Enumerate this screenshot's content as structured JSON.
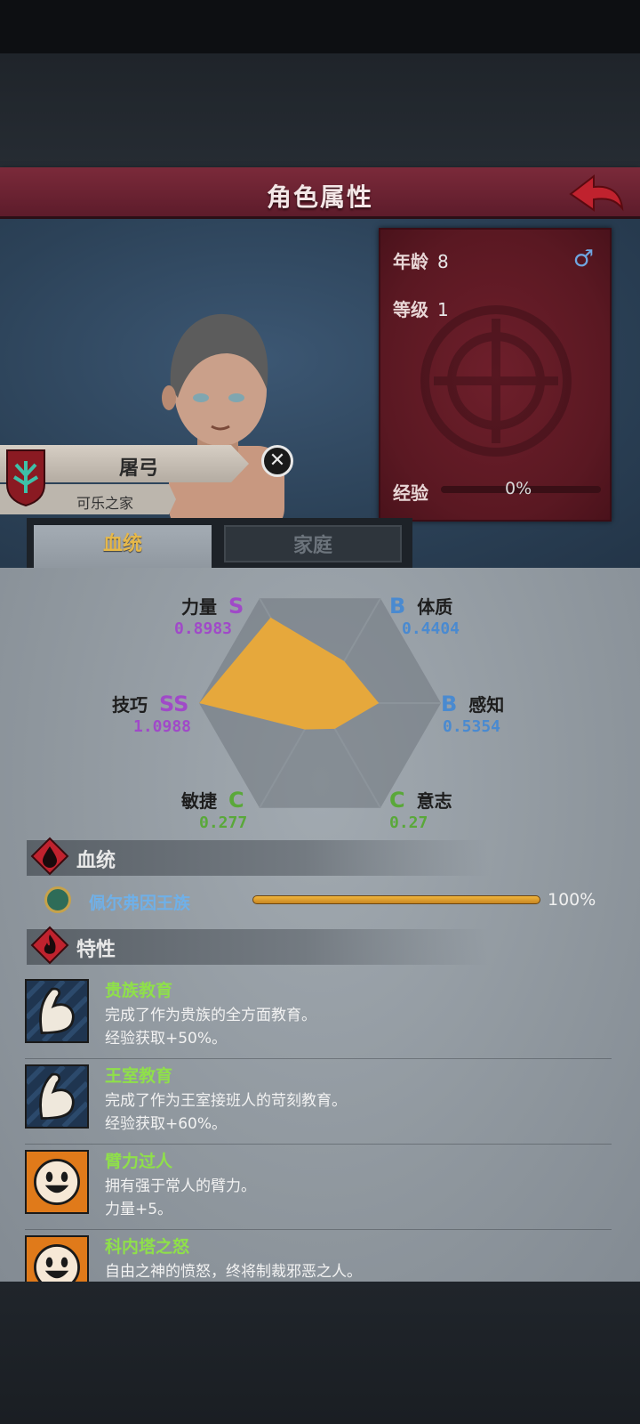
{
  "header": {
    "title": "角色属性"
  },
  "character": {
    "name": "屠弓",
    "family": "可乐之家",
    "age_label": "年龄",
    "age": "8",
    "level_label": "等级",
    "level": "1",
    "gender_symbol": "♂",
    "exp_label": "经验",
    "exp_value": "0%"
  },
  "tabs": [
    {
      "label": "血统",
      "active": true
    },
    {
      "label": "家庭",
      "active": false
    }
  ],
  "attributes": [
    {
      "name": "力量",
      "grade": "S",
      "value": "0.8983",
      "color": "#a04ac8"
    },
    {
      "name": "体质",
      "grade": "B",
      "value": "0.4404",
      "color": "#4a8ad0"
    },
    {
      "name": "感知",
      "grade": "B",
      "value": "0.5354",
      "color": "#4a8ad0"
    },
    {
      "name": "意志",
      "grade": "C",
      "value": "0.27",
      "color": "#5aa83a"
    },
    {
      "name": "敏捷",
      "grade": "C",
      "value": "0.277",
      "color": "#5aa83a"
    },
    {
      "name": "技巧",
      "grade": "SS",
      "value": "1.0988",
      "color": "#a04ac8"
    }
  ],
  "lineage_section": {
    "title": "血统",
    "entries": [
      {
        "name": "佩尔弗因王族",
        "percent": "100%",
        "fraction": 1.0
      }
    ]
  },
  "traits_section": {
    "title": "特性",
    "items": [
      {
        "title": "贵族教育",
        "desc": "完成了作为贵族的全方面教育。",
        "effect": "经验获取+50%。",
        "icon": "muscle-arm-icon"
      },
      {
        "title": "王室教育",
        "desc": "完成了作为王室接班人的苛刻教育。",
        "effect": "经验获取+60%。",
        "icon": "muscle-arm-icon"
      },
      {
        "title": "臂力过人",
        "desc": "拥有强于常人的臂力。",
        "effect": "力量+5。",
        "icon": "smiling-face-icon"
      },
      {
        "title": "科内塔之怒",
        "desc": "自由之神的愤怒，终将制裁邪恶之人。",
        "effect": "",
        "icon": "smiling-face-icon"
      }
    ]
  },
  "colors": {
    "header": "#6b2333",
    "radar_fill": "#e6a83c",
    "trait_title": "#8fe04a",
    "lineage_name": "#6fb0e8"
  }
}
